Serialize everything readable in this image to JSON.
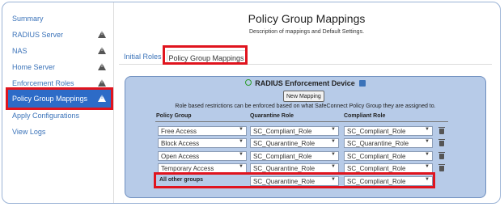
{
  "sidebar": {
    "items": [
      {
        "label": "Summary",
        "warning": false
      },
      {
        "label": "RADIUS Server",
        "warning": true
      },
      {
        "label": "NAS",
        "warning": true
      },
      {
        "label": "Home Server",
        "warning": true
      },
      {
        "label": "Enforcement Roles",
        "warning": true
      },
      {
        "label": "Policy Group Mappings",
        "warning": true,
        "active": true
      },
      {
        "label": "Apply Configurations",
        "warning": false
      },
      {
        "label": "View Logs",
        "warning": false
      }
    ]
  },
  "header": {
    "title": "Policy Group Mappings",
    "description": "Description of mappings and Default Settings."
  },
  "tabs": [
    {
      "label": "Initial Roles"
    },
    {
      "label": "Policy Group Mappings",
      "active": true
    }
  ],
  "panel": {
    "title": "RADIUS Enforcement Device",
    "new_mapping_label": "New Mapping",
    "note": "Role based restrictions can be enforced based on what SafeConnect Policy Group they are assigned to.",
    "columns": [
      "Policy Group",
      "Quarantine Role",
      "Compliant Role"
    ],
    "rows": [
      {
        "group": "Free Access",
        "quarantine": "SC_Compliant_Role",
        "compliant": "SC_Compliant_Role"
      },
      {
        "group": "Block Access",
        "quarantine": "SC_Quarantine_Role",
        "compliant": "SC_Quarantine_Role"
      },
      {
        "group": "Open Access",
        "quarantine": "SC_Compliant_Role",
        "compliant": "SC_Compliant_Role"
      },
      {
        "group": "Temporary Access",
        "quarantine": "SC_Quarantine_Role",
        "compliant": "SC_Compliant_Role"
      }
    ],
    "other": {
      "label": "All other groups",
      "quarantine": "SC_Quarantine_Role",
      "compliant": "SC_Compliant_Role"
    }
  },
  "colors": {
    "accent": "#2d6bc7",
    "link": "#3b73b9",
    "highlight": "#e0141e",
    "panel_bg": "#b7cbe8"
  }
}
